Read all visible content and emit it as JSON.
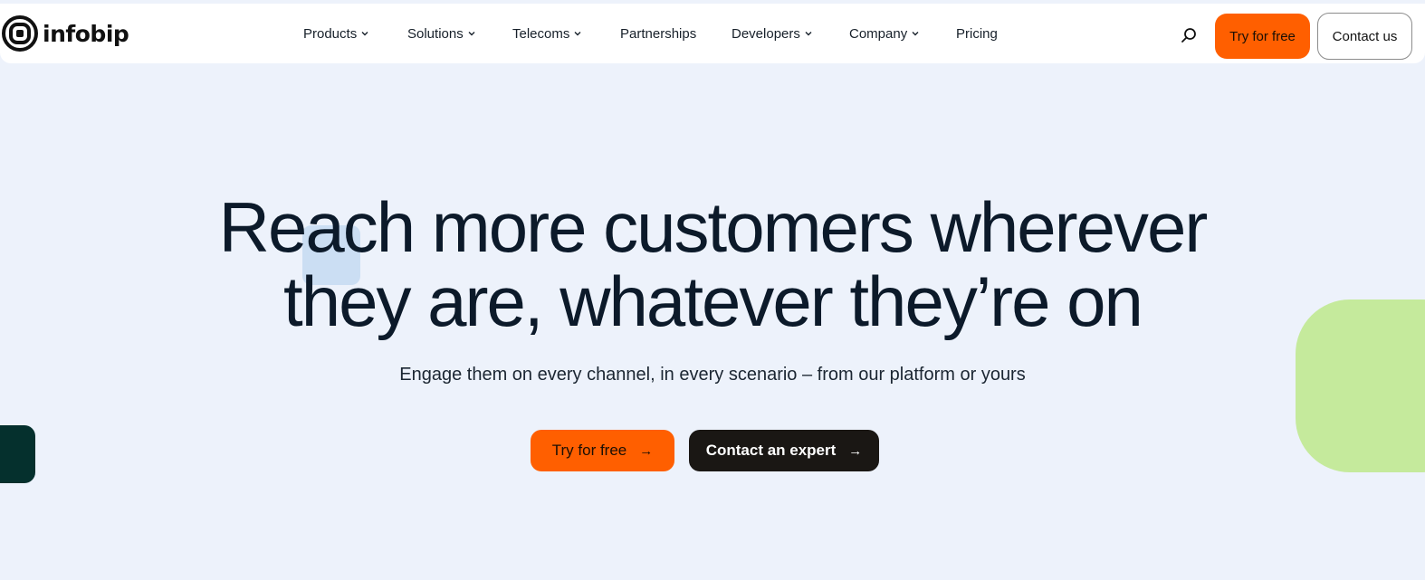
{
  "brand": {
    "name": "infobip",
    "accent_color": "#ff5f00",
    "dark_button_color": "#1a1714"
  },
  "nav": {
    "items": [
      {
        "label": "Products",
        "has_dropdown": true
      },
      {
        "label": "Solutions",
        "has_dropdown": true
      },
      {
        "label": "Telecoms",
        "has_dropdown": true
      },
      {
        "label": "Partnerships",
        "has_dropdown": false
      },
      {
        "label": "Developers",
        "has_dropdown": true
      },
      {
        "label": "Company",
        "has_dropdown": true
      },
      {
        "label": "Pricing",
        "has_dropdown": false
      }
    ],
    "search_icon": "search-icon",
    "try_label": "Try for free",
    "contact_label": "Contact us"
  },
  "hero": {
    "title_line1": "Reach more customers wherever",
    "title_line2": "they are, whatever they’re on",
    "subtitle": "Engage them on every channel, in every scenario – from our platform or yours",
    "primary_label": "Try for free",
    "secondary_label": "Contact an expert"
  }
}
